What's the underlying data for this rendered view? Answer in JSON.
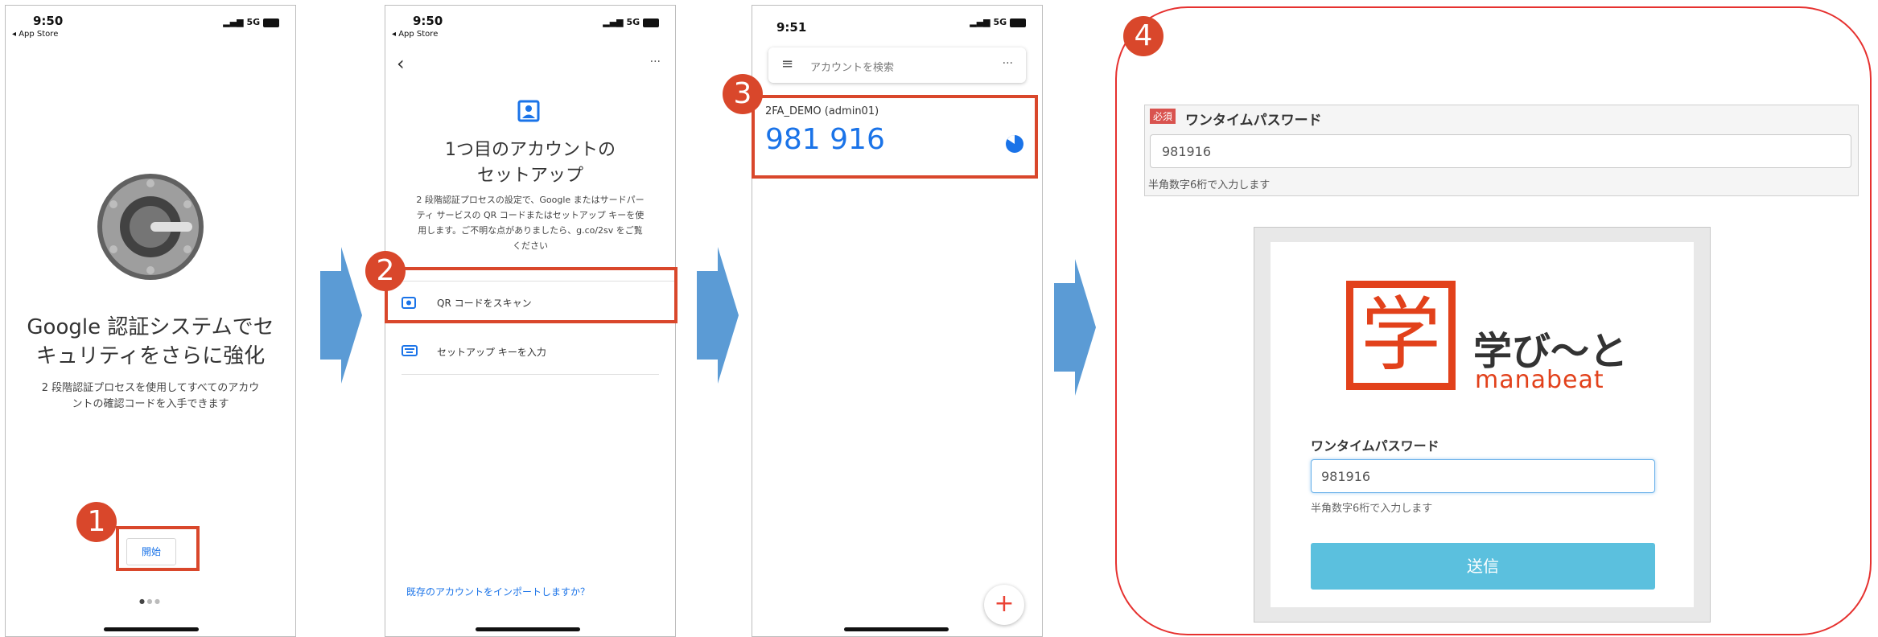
{
  "screen1": {
    "time": "9:50",
    "back_label": "◂ App Store",
    "signal": "5G",
    "headline_line1": "Google 認証システムでセ",
    "headline_line2": "キュリティをさらに強化",
    "body_line1": "2 段階認証プロセスを使用してすべてのアカウ",
    "body_line2": "ントの確認コードを入手できます",
    "start_button": "開始",
    "step": "1"
  },
  "screen2": {
    "time": "9:50",
    "back_label": "◂ App Store",
    "signal": "5G",
    "more_label": "···",
    "title_line1": "1つ目のアカウントの",
    "title_line2": "セットアップ",
    "desc_line1": "2 段階認証プロセスの設定で、Google またはサードパー",
    "desc_line2": "ティ サービスの QR コードまたはセットアップ キーを使",
    "desc_line3": "用します。ご不明な点がありましたら、g.co/2sv をご覧",
    "desc_line4": "ください",
    "qr_option": "QR コードをスキャン",
    "key_option": "セットアップ キーを入力",
    "import_link": "既存のアカウントをインポートしますか？",
    "step": "2"
  },
  "screen3": {
    "time": "9:51",
    "signal": "5G",
    "search_placeholder": "アカウントを検索",
    "more_label": "···",
    "account_name": "2FA_DEMO (admin01)",
    "code": "981 916",
    "step": "3"
  },
  "screen4": {
    "step": "4",
    "required_badge": "必須",
    "otp_label": "ワンタイムパスワード",
    "otp_value": "981916",
    "otp_hint": "半角数字6桁で入力します",
    "logo_kanji": "学",
    "logo_text": "学び〜と",
    "logo_sub": "manabeat",
    "form_label": "ワンタイムパスワード",
    "form_value": "981916",
    "form_hint": "半角数字6桁で入力します",
    "submit_label": "送信"
  },
  "colors": {
    "accent_red": "#d9472b",
    "arrow_blue": "#5b9bd5",
    "google_blue": "#1a73e8",
    "submit_blue": "#5bc0de"
  }
}
